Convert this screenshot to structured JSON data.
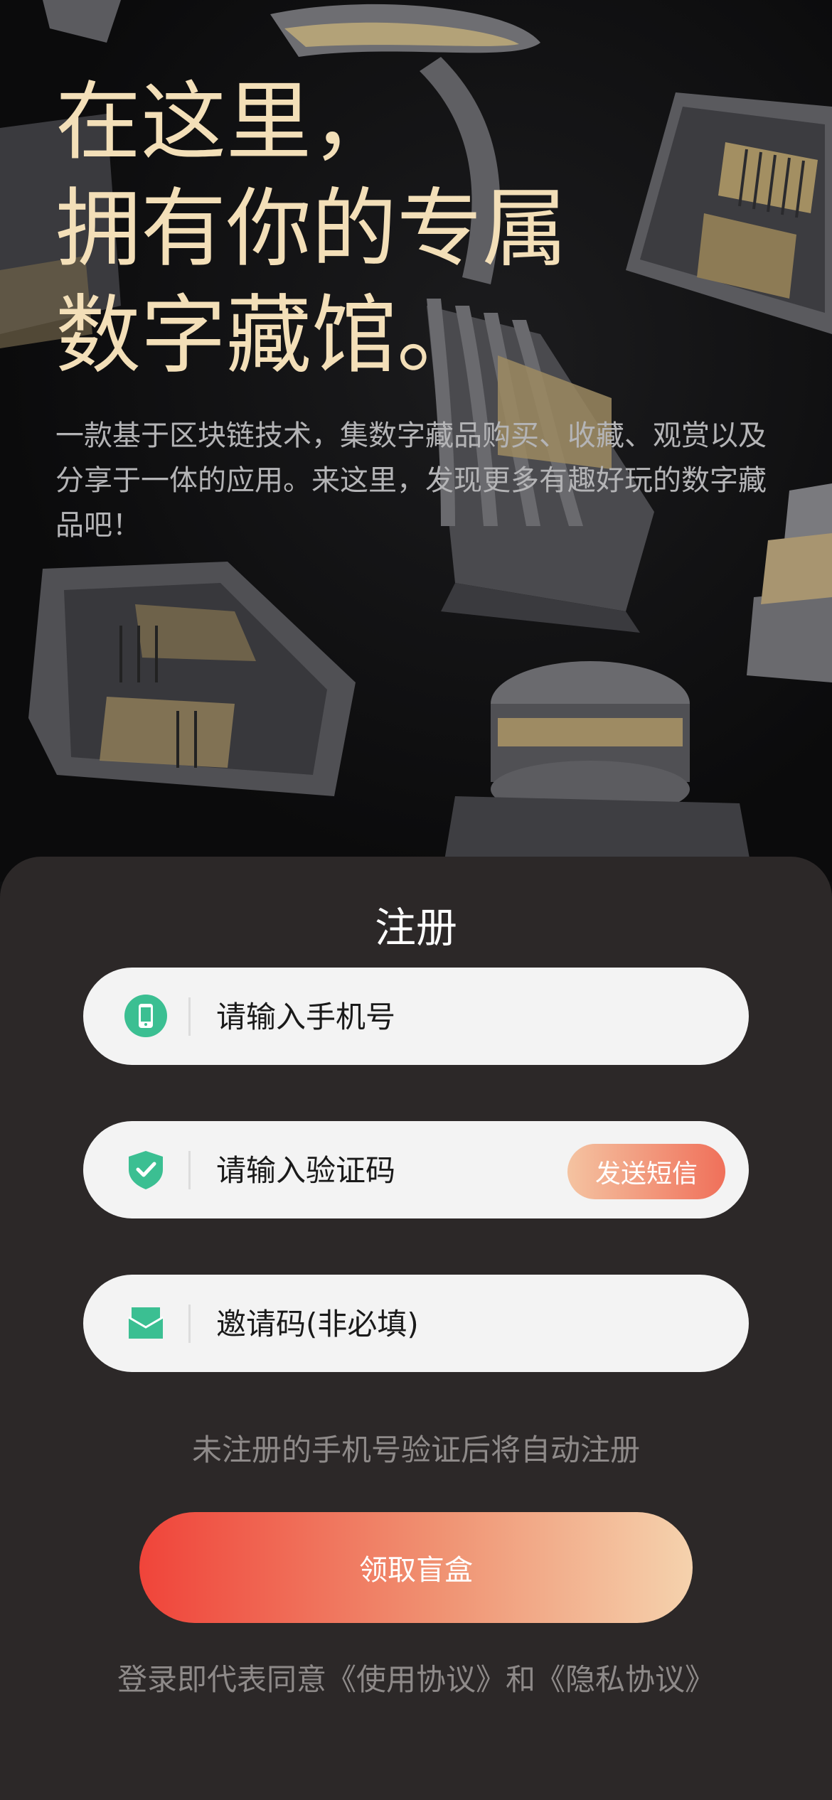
{
  "hero": {
    "title_lines": [
      "在这里，",
      "拥有你的专属",
      "数字藏馆。"
    ],
    "description": "一款基于区块链技术，集数字藏品购买、收藏、观赏以及分享于一体的应用。来这里，发现更多有趣好玩的数字藏品吧！"
  },
  "register": {
    "title": "注册",
    "phone": {
      "placeholder": "请输入手机号",
      "value": "",
      "icon": "phone-icon"
    },
    "code": {
      "placeholder": "请输入验证码",
      "value": "",
      "icon": "shield-check-icon",
      "send_label": "发送短信"
    },
    "invite": {
      "placeholder": "邀请码(非必填)",
      "value": "",
      "icon": "mail-icon"
    },
    "hint": "未注册的手机号验证后将自动注册",
    "submit_label": "领取盲盒",
    "agreement": {
      "prefix": "登录即代表同意",
      "terms": "《使用协议》",
      "joiner": "和",
      "privacy": "《隐私协议》"
    }
  },
  "colors": {
    "title_gold": "#f3dfb8",
    "panel_bg": "#2c2828",
    "icon_green": "#3bbf92",
    "button_red": "#f0443a",
    "button_peach": "#f5d2ad"
  }
}
